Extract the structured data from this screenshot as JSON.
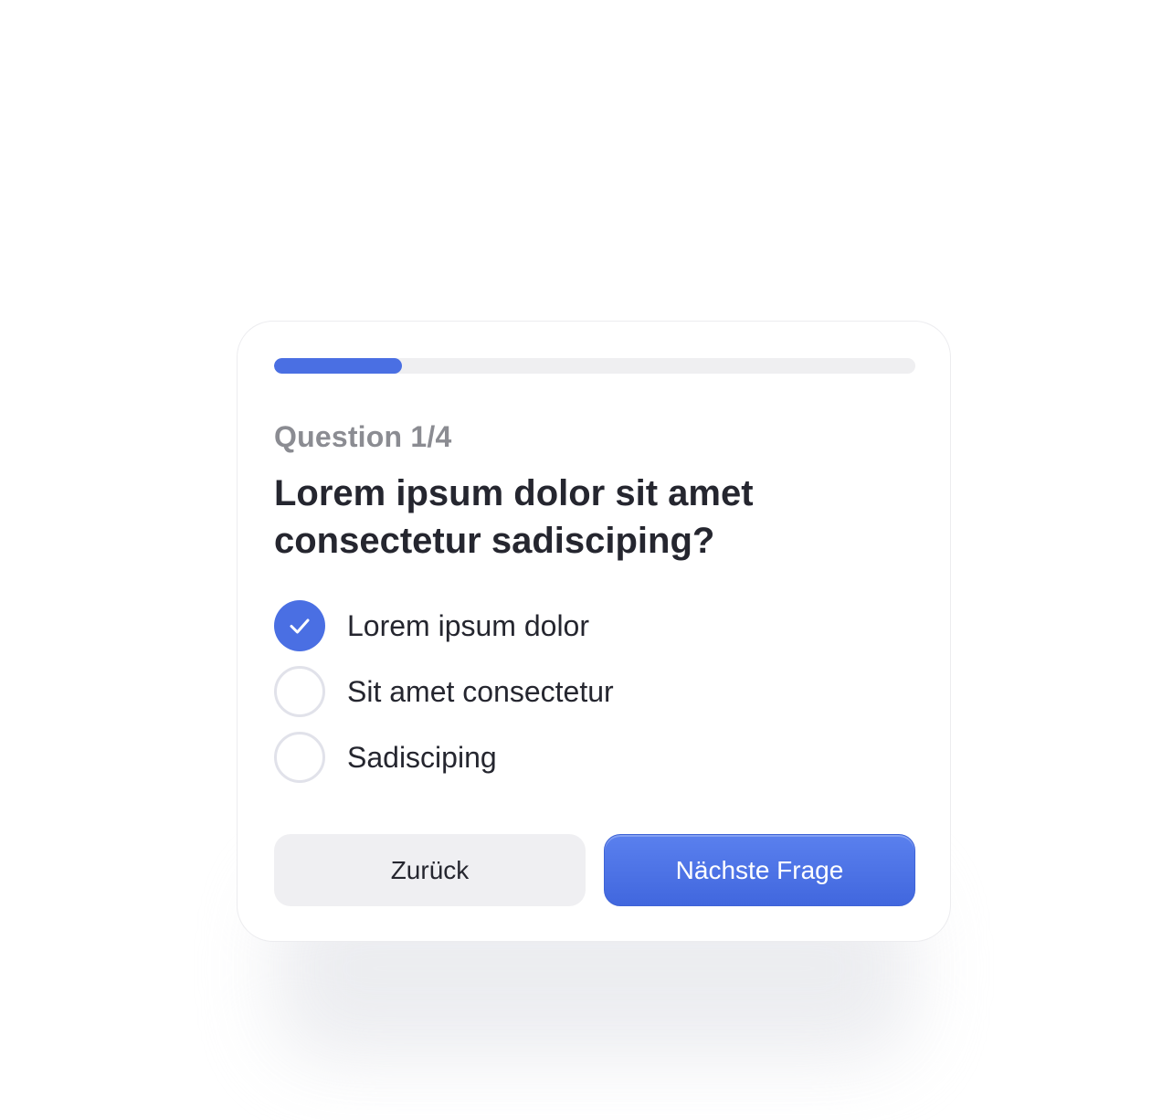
{
  "quiz": {
    "progress_fraction": 0.2,
    "accent_color": "#4a6fe3",
    "counter": "Question 1/4",
    "question": "Lorem ipsum dolor sit amet consectetur sadisciping?",
    "options": [
      {
        "label": "Lorem ipsum dolor",
        "selected": true
      },
      {
        "label": "Sit amet consectetur",
        "selected": false
      },
      {
        "label": "Sadisciping",
        "selected": false
      }
    ],
    "check_icon": "check-icon",
    "back_label": "Zurück",
    "next_label": "Nächste Frage"
  }
}
